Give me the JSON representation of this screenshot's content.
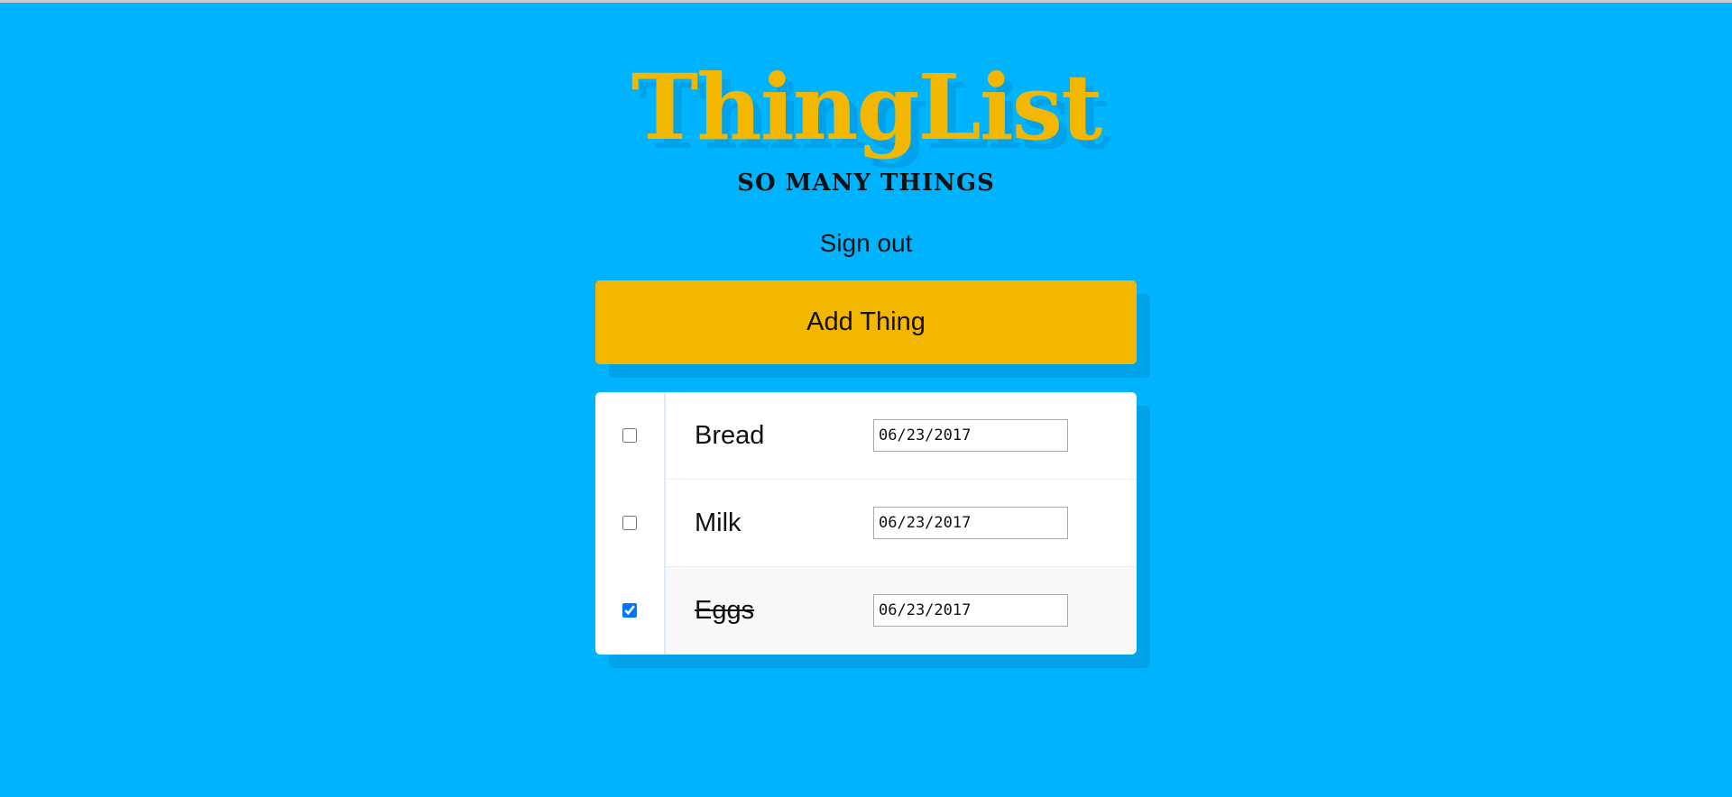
{
  "header": {
    "logo": "ThingList",
    "tagline": "SO MANY THINGS",
    "signout_label": "Sign out"
  },
  "actions": {
    "add_label": "Add Thing"
  },
  "things": [
    {
      "name": "Bread",
      "date": "06/23/2017",
      "checked": false
    },
    {
      "name": "Milk",
      "date": "06/23/2017",
      "checked": false
    },
    {
      "name": "Eggs",
      "date": "06/23/2017",
      "checked": true
    }
  ],
  "colors": {
    "background": "#00b3ff",
    "accent": "#f4b700",
    "shadow": "#00a3ea"
  }
}
